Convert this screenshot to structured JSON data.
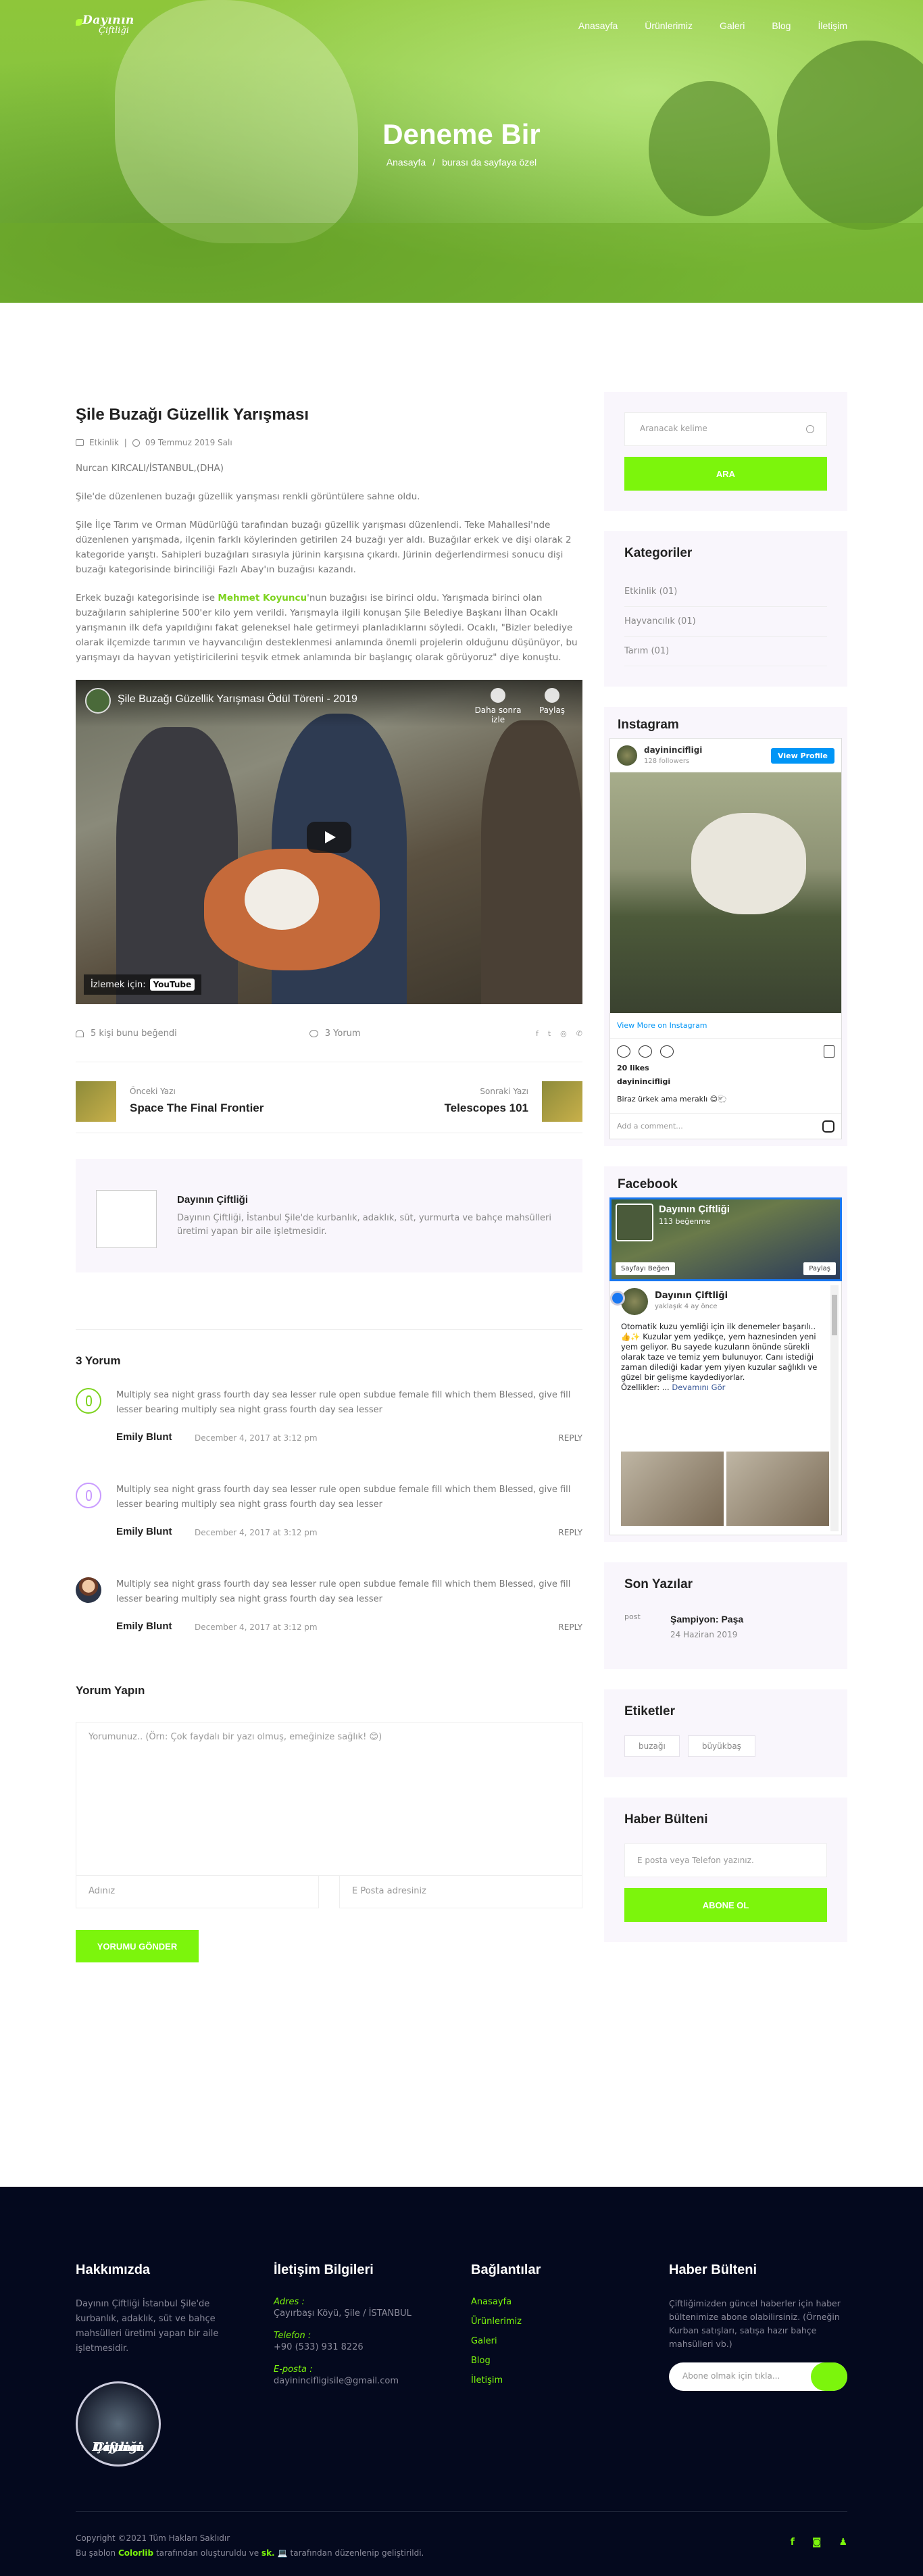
{
  "header": {
    "logo_line1": "Dayının",
    "logo_line2": "Çiftliği",
    "nav": [
      "Anasayfa",
      "Ürünlerimiz",
      "Galeri",
      "Blog",
      "İletişim"
    ]
  },
  "hero": {
    "title": "Deneme Bir",
    "breadcrumb_home": "Anasayfa",
    "breadcrumb_sep": "/",
    "breadcrumb_current": "burası da sayfaya özel"
  },
  "post": {
    "title": "Şile Buzağı Güzellik Yarışması",
    "category": "Etkinlik",
    "meta_sep": "|",
    "date": "09 Temmuz 2019 Salı",
    "byline": "Nurcan KIRCALI/İSTANBUL,(DHA)",
    "p1": "Şile'de düzenlenen buzağı güzellik yarışması renkli görüntülere sahne oldu.",
    "p2": "Şile İlçe Tarım ve Orman Müdürlüğü tarafından buzağı güzellik yarışması düzenlendi. Teke Mahallesi'nde düzenlenen yarışmada, ilçenin farklı köylerinden getirilen 24 buzağı yer aldı. Buzağılar erkek ve dişi olarak 2 kategoride yarıştı. Sahipleri buzağıları sırasıyla jürinin karşısına çıkardı. Jürinin değerlendirmesi sonucu dişi buzağı kategorisinde birinciliği Fazlı Abay'ın buzağısı kazandı.",
    "p3_before": "Erkek buzağı kategorisinde ise ",
    "p3_highlight": "Mehmet Koyuncu",
    "p3_after": "'nun buzağısı ise birinci oldu. Yarışmada birinci olan buzağıların sahiplerine 500'er kilo yem verildi. Yarışmayla ilgili konuşan Şile Belediye Başkanı İlhan Ocaklı yarışmanın ilk defa yapıldığını fakat geleneksel hale getirmeyi planladıklarını söyledi. Ocaklı, \"Bizler belediye olarak ilçemizde tarımın ve hayvancılığın desteklenmesi anlamında önemli projelerin olduğunu düşünüyor, bu yarışmayı da hayvan yetiştiricilerini teşvik etmek anlamında bir başlangıç olarak görüyoruz\" diye konuştu.",
    "video": {
      "title": "Şile Buzağı Güzellik Yarışması Ödül Töreni - 2019",
      "watch_later": "Daha sonra izle",
      "share": "Paylaş",
      "watch_on": "İzlemek için:",
      "youtube": "YouTube"
    },
    "likes": "5 kişi bunu beğendi",
    "comments_count": "3 Yorum",
    "social_icons": [
      "f",
      "t",
      "◎",
      "✆"
    ],
    "prev_label": "Önceki Yazı",
    "prev_title": "Space The Final Frontier",
    "next_label": "Sonraki Yazı",
    "next_title": "Telescopes 101"
  },
  "author": {
    "name": "Dayının Çiftliği",
    "desc": "Dayının Çiftliği, İstanbul Şile'de kurbanlık, adaklık, süt, yurmurta ve bahçe mahsülleri üretimi yapan bir aile işletmesidir."
  },
  "comments": {
    "heading": "3 Yorum",
    "items": [
      {
        "text": "Multiply sea night grass fourth day sea lesser rule open subdue female fill which them Blessed, give fill lesser bearing multiply sea night grass fourth day sea lesser",
        "name": "Emily Blunt",
        "date": "December 4, 2017 at 3:12 pm",
        "reply": "REPLY"
      },
      {
        "text": "Multiply sea night grass fourth day sea lesser rule open subdue female fill which them Blessed, give fill lesser bearing multiply sea night grass fourth day sea lesser",
        "name": "Emily Blunt",
        "date": "December 4, 2017 at 3:12 pm",
        "reply": "REPLY"
      },
      {
        "text": "Multiply sea night grass fourth day sea lesser rule open subdue female fill which them Blessed, give fill lesser bearing multiply sea night grass fourth day sea lesser",
        "name": "Emily Blunt",
        "date": "December 4, 2017 at 3:12 pm",
        "reply": "REPLY"
      }
    ]
  },
  "form": {
    "heading": "Yorum Yapın",
    "comment_placeholder": "Yorumunuz.. (Örn: Çok faydalı bir yazı olmuş, emeğinize sağlık! 😊)",
    "name_placeholder": "Adınız",
    "email_placeholder": "E Posta adresiniz",
    "submit": "YORUMU GÖNDER"
  },
  "sidebar": {
    "search_placeholder": "Aranacak kelime",
    "search_button": "ARA",
    "categories_heading": "Kategoriler",
    "categories": [
      "Etkinlik (01)",
      "Hayvancılık (01)",
      "Tarım (01)"
    ],
    "instagram_heading": "Instagram",
    "instagram": {
      "username": "dayinincifligi",
      "followers": "128 followers",
      "view_profile": "View Profile",
      "view_more": "View More on Instagram",
      "likes": "20 likes",
      "caption_user": "dayinincifligi",
      "caption": "Biraz ürkek ama meraklı 😊🐑",
      "add_comment": "Add a comment..."
    },
    "facebook_heading": "Facebook",
    "facebook": {
      "page_name": "Dayının Çiftliği",
      "followers": "113 beğenme",
      "like_button": "Sayfayı Beğen",
      "share_button": "Paylaş",
      "post_author": "Dayının Çiftliği",
      "post_time": "yaklaşık 4 ay önce",
      "post_text": "Otomatik kuzu yemliği için ilk denemeler başarılı.. 👍✨ Kuzular yem yedikçe, yem haznesinden yeni yem geliyor. Bu sayede kuzuların önünde sürekli olarak taze ve temiz yem bulunuyor. Canı istediği zaman dilediği kadar yem yiyen kuzular sağlıklı ve güzel bir gelişme kaydediyorlar.",
      "post_tail": "Özellikler: ...",
      "see_more": "Devamını Gör"
    },
    "recent_heading": "Son Yazılar",
    "recent": {
      "img_alt": "post",
      "title": "Şampiyon: Paşa",
      "date": "24 Haziran 2019"
    },
    "tags_heading": "Etiketler",
    "tags": [
      "buzağı",
      "büyükbaş"
    ],
    "newsletter_heading": "Haber Bülteni",
    "newsletter_placeholder": "E posta veya Telefon yazınız.",
    "newsletter_button": "ABONE OL"
  },
  "footer": {
    "about_heading": "Hakkımızda",
    "about_text": "Dayının Çiftliği İstanbul Şile'de kurbanlık, adaklık, süt ve bahçe mahsülleri üretimi yapan bir aile işletmesidir.",
    "logo_line1": "Dayının",
    "logo_line2": "Çiftliği",
    "contact_heading": "İletişim Bilgileri",
    "address_label": "Adres :",
    "address": "Çayırbaşı Köyü, Şile / İSTANBUL",
    "phone_label": "Telefon :",
    "phone": "+90 (533) 931 8226",
    "email_label": "E-posta :",
    "email": "dayinincifligisile@gmail.com",
    "links_heading": "Bağlantılar",
    "links": [
      "Anasayfa",
      "Ürünlerimiz",
      "Galeri",
      "Blog",
      "İletişim"
    ],
    "nl_heading": "Haber Bülteni",
    "nl_text": "Çiftliğimizden güncel haberler için haber bültenimize abone olabilirsiniz. (Örneğin Kurban satışları, satışa hazır bahçe mahsülleri vb.)",
    "nl_placeholder": "Abone olmak için tıkla...",
    "copyright": "Copyright ©2021 Tüm Hakları Saklıdır",
    "credit_before": "Bu şablon ",
    "credit_colorlib": "Colorlib",
    "credit_mid": " tarafından oluşturuldu ve ",
    "credit_sk": "sk. 💻",
    "credit_after": " tarafından düzenlenip geliştirildi.",
    "social": [
      "f",
      "◙",
      "♟"
    ]
  }
}
